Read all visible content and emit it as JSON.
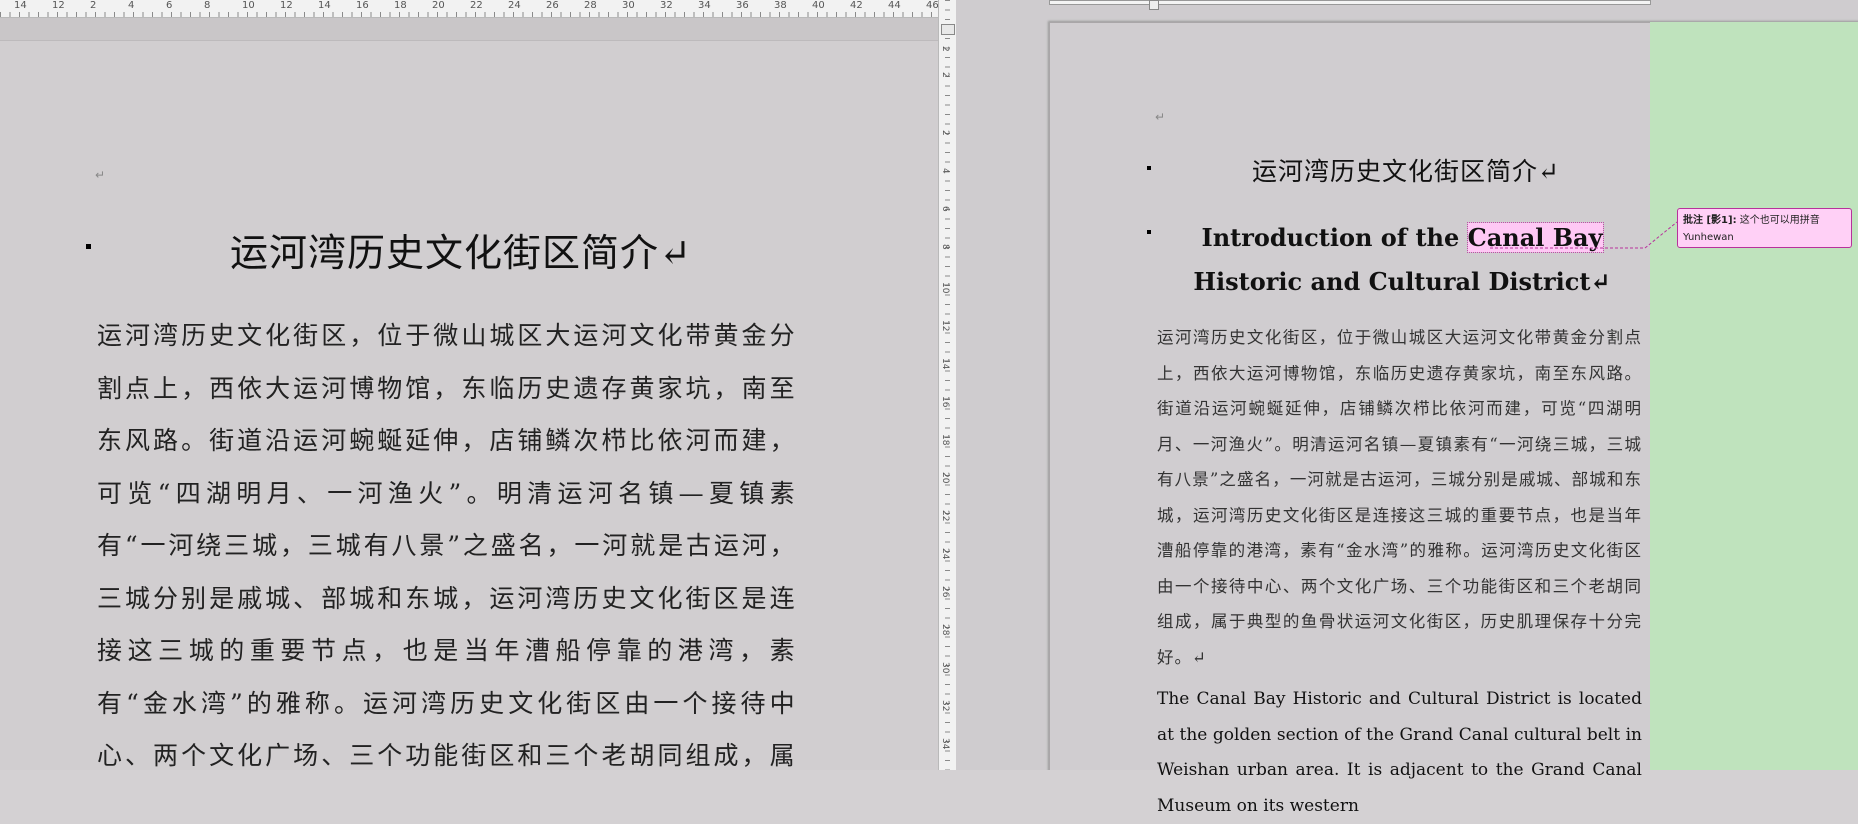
{
  "ruler_top_left": {
    "labels": [
      "14",
      "12",
      "2",
      "4",
      "6",
      "8",
      "10",
      "12",
      "14",
      "16",
      "18",
      "20",
      "22",
      "24",
      "26",
      "28",
      "30",
      "32",
      "34",
      "36",
      "38",
      "40",
      "42",
      "44",
      "46"
    ]
  },
  "ruler_top_right": {
    "labels": []
  },
  "ruler_vertical": {
    "labels": [
      "2",
      "4",
      "6",
      "8",
      "10",
      "12",
      "14",
      "16",
      "18",
      "20",
      "22",
      "24",
      "26",
      "28",
      "30",
      "32",
      "34",
      "36"
    ],
    "top_labels": [
      "2",
      "2"
    ]
  },
  "para_mark": "↵",
  "left_doc": {
    "title": "运河湾历史文化街区简介↵",
    "body": "运河湾历史文化街区，位于微山城区大运河文化带黄金分割点上，西依大运河博物馆，东临历史遗存黄家坑，南至东风路。街道沿运河蜿蜒延伸，店铺鳞次栉比依河而建，可览“四湖明月、一河渔火”。明清运河名镇—夏镇素有“一河绕三城，三城有八景”之盛名，一河就是古运河，三城分别是戚城、部城和东城，运河湾历史文化街区是连接这三城的重要节点，也是当年漕船停靠的港湾，素有“金水湾”的雅称。运河湾历史文化街区由一个接待中心、两个文化广场、三个功能街区和三个老胡同组成，属于典型的鱼骨状运河文化街"
  },
  "right_doc": {
    "title_cn": "运河湾历史文化街区简介↵",
    "title_en_pre": "Introduction of the ",
    "title_en_highlight": "Canal Bay",
    "title_en_post": " Historic and Cultural District↵",
    "body_cn": "运河湾历史文化街区，位于微山城区大运河文化带黄金分割点上，西依大运河博物馆，东临历史遗存黄家坑，南至东风路。街道沿运河蜿蜒延伸，店铺鳞次栉比依河而建，可览“四湖明月、一河渔火”。明清运河名镇—夏镇素有“一河绕三城，三城有八景”之盛名，一河就是古运河，三城分别是戚城、部城和东城，运河湾历史文化街区是连接这三城的重要节点，也是当年漕船停靠的港湾，素有“金水湾”的雅称。运河湾历史文化街区由一个接待中心、两个文化广场、三个功能街区和三个老胡同组成，属于典型的鱼骨状运河文化街区，历史肌理保存十分完好。↵",
    "body_en": "The Canal Bay Historic and Cultural District is located at the golden section of the Grand Canal cultural belt in Weishan urban area. It is adjacent to the Grand Canal Museum on its western"
  },
  "comment": {
    "label": "批注 [影1]:",
    "text": " 这个也可以用拼音 Yunhewan"
  },
  "colors": {
    "markup_pane": "#bfe3bd",
    "comment_bg": "#ffd0f6",
    "comment_border": "#b7329b",
    "highlight": "#ffc8f5"
  }
}
